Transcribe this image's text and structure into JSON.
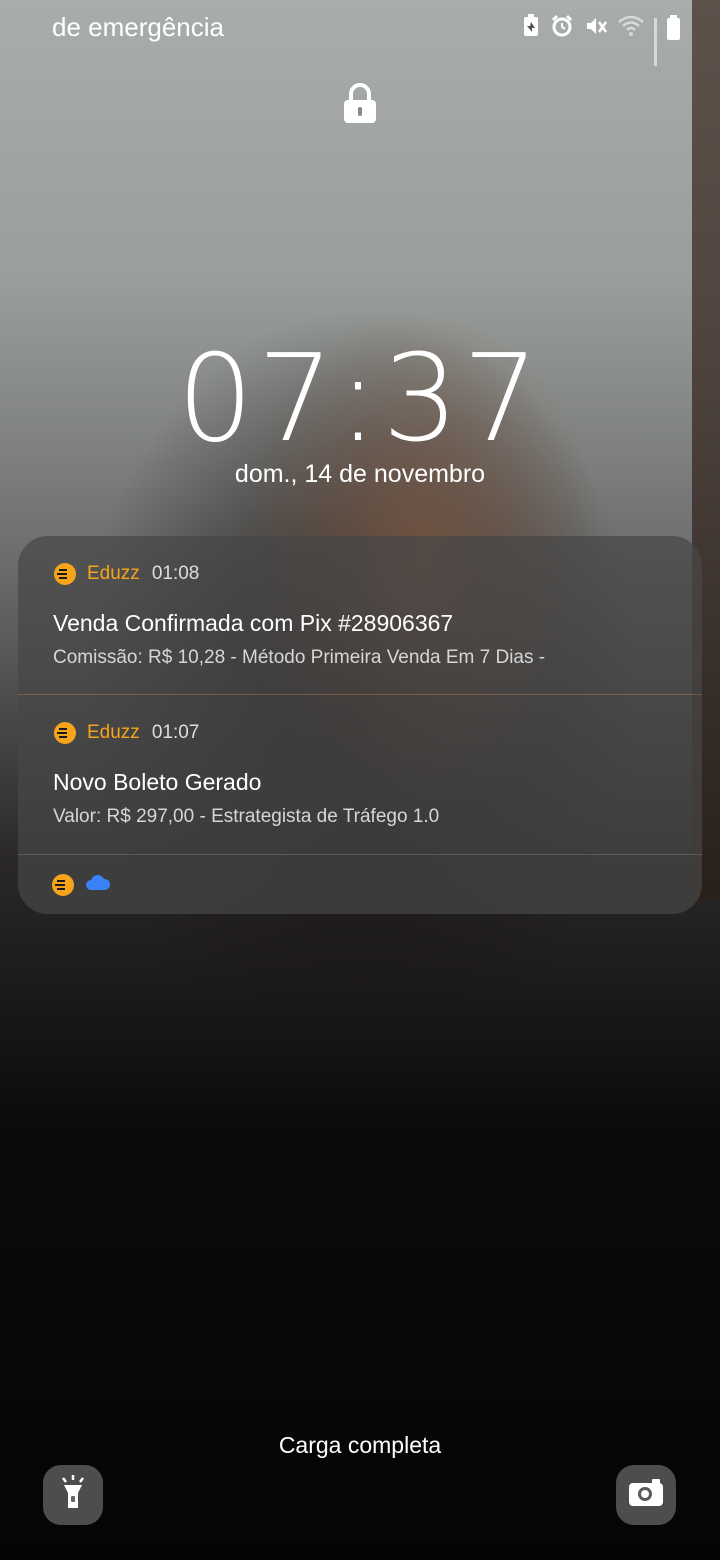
{
  "status_bar": {
    "carrier_text": "de emergência",
    "icons": [
      "battery-saver-icon",
      "alarm-icon",
      "mute-icon",
      "wifi-icon",
      "signal-icon",
      "battery-icon"
    ]
  },
  "lock_icon": "lock-icon",
  "clock": {
    "time": "07:37",
    "date": "dom., 14 de novembro"
  },
  "notifications": [
    {
      "app": "Eduzz",
      "time": "01:08",
      "title": "Venda Confirmada com Pix #28906367",
      "body": "Comissão: R$ 10,28 - Método Primeira Venda Em 7 Dias -"
    },
    {
      "app": "Eduzz",
      "time": "01:07",
      "title": "Novo Boleto Gerado",
      "body": "Valor: R$ 297,00 - Estrategista de Tráfego 1.0"
    }
  ],
  "footer_icons": [
    "eduzz-icon",
    "cloud-icon"
  ],
  "colors": {
    "app_accent": "#f6a51a",
    "cloud": "#3b82f6"
  },
  "charging_text": "Carga completa",
  "shortcuts": {
    "left": "flashlight-icon",
    "right": "camera-icon"
  }
}
